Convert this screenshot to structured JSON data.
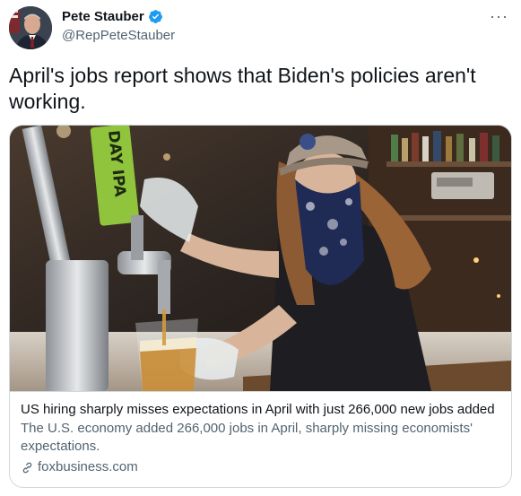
{
  "author": {
    "display_name": "Pete Stauber",
    "handle": "@RepPeteStauber"
  },
  "tweet": {
    "text": "April's jobs report shows that Biden's policies aren't working."
  },
  "card": {
    "title": "US hiring sharply misses expectations in April with just 266,000 new jobs added",
    "description": "The U.S. economy added 266,000 jobs in April, sharply missing economists' expectations.",
    "domain": "foxbusiness.com",
    "tap_label": "DAY IPA"
  },
  "menu": {
    "more_label": "···"
  },
  "colors": {
    "verified_badge": "#1d9bf0",
    "secondary_text": "#536471",
    "border": "#cfd9de"
  },
  "icons": {
    "verified": "verified-badge-icon",
    "link": "link-icon",
    "more": "more-options-icon"
  }
}
